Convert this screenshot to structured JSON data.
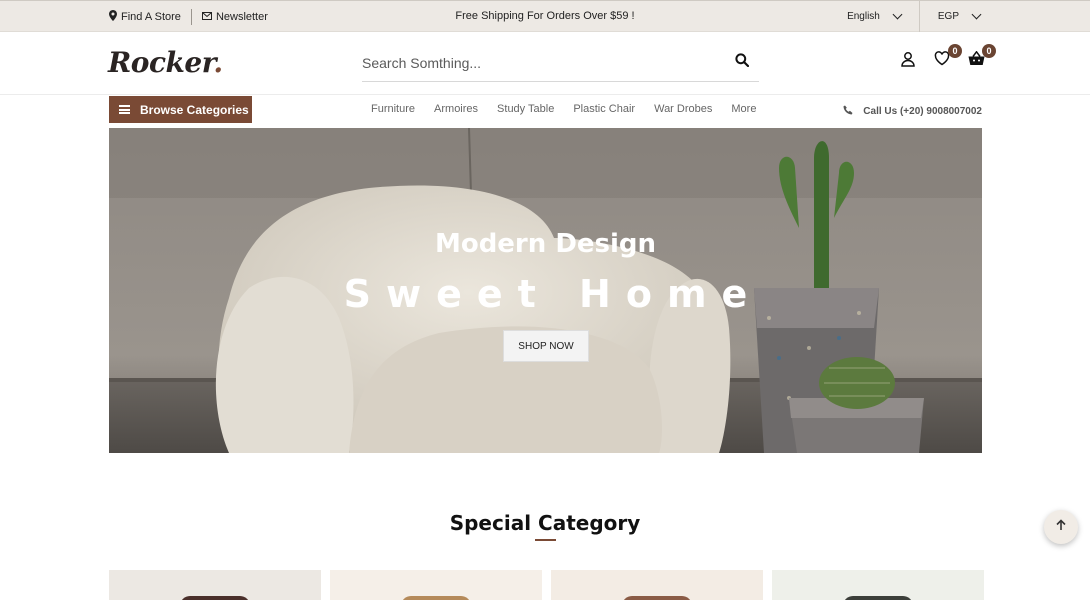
{
  "topbar": {
    "find_store": "Find A Store",
    "newsletter": "Newsletter",
    "promo": "Free Shipping For Orders Over $59 !",
    "language": "English",
    "currency": "EGP"
  },
  "header": {
    "logo_text": "Rocker",
    "logo_dot": ".",
    "search_placeholder": "Search Somthing...",
    "wishlist_count": "0",
    "cart_count": "0"
  },
  "nav": {
    "browse_label": "Browse Categories",
    "menu": [
      "Furniture",
      "Armoires",
      "Study Table",
      "Plastic Chair",
      "War Drobes",
      "More"
    ],
    "call_us": "Call Us (+20) 9008007002"
  },
  "hero": {
    "title": "Modern Design",
    "subtitle": "Sweet Home",
    "button": "SHOP NOW"
  },
  "special": {
    "title": "Special Category"
  },
  "colors": {
    "brand": "#7a4a35",
    "topbar_bg": "#ede9e4",
    "badge": "#6a4432"
  },
  "icons": [
    "map-marker-icon",
    "envelope-icon",
    "search-icon",
    "user-icon",
    "heart-icon",
    "basket-icon",
    "phone-icon",
    "arrow-up-icon"
  ]
}
